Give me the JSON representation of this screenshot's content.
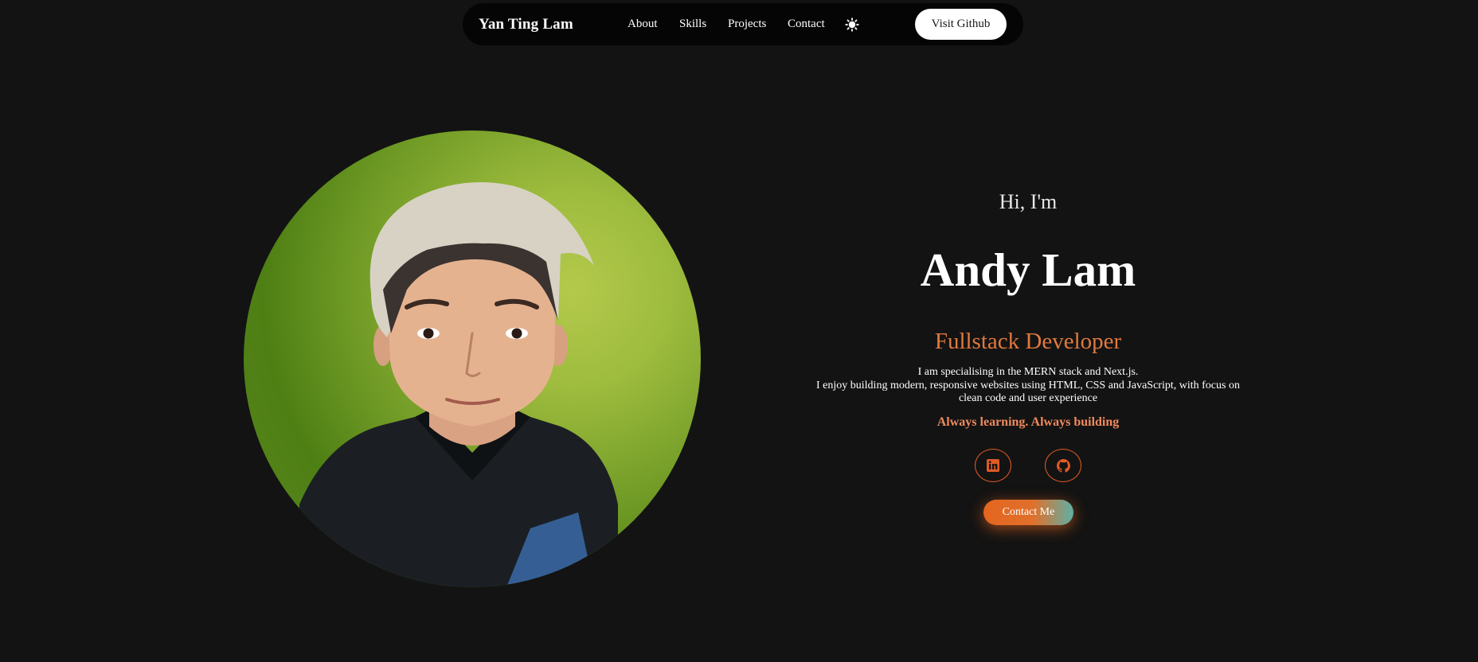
{
  "nav": {
    "brand": "Yan Ting Lam",
    "links": [
      "About",
      "Skills",
      "Projects",
      "Contact"
    ],
    "theme_icon": "sun-icon",
    "github_button": "Visit Github"
  },
  "hero": {
    "greeting": "Hi, I'm",
    "name": "Andy Lam",
    "role": "Fullstack Developer",
    "bio_line1": "I am specialising in the MERN stack and Next.js.",
    "bio_line2": "I enjoy building modern, responsive websites using HTML, CSS and JavaScript, with focus on clean code and user experience",
    "tagline": "Always learning. Always building",
    "socials": [
      "linkedin-icon",
      "github-icon"
    ],
    "contact_button": "Contact Me"
  },
  "colors": {
    "background": "#131313",
    "nav_background": "#050505",
    "accent": "#e0793f",
    "tagline": "#ef8a5e",
    "portrait_background": "#8fb436"
  }
}
